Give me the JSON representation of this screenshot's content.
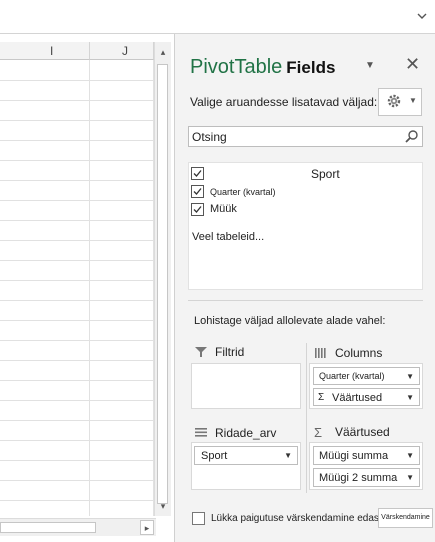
{
  "formula_bar": {
    "expand_icon": "chevron-down-icon"
  },
  "sheet": {
    "columns": [
      "I",
      "J"
    ],
    "hscroll_right_arrow": "▸",
    "vscroll_up_arrow": "▴",
    "vscroll_down_arrow": "▾"
  },
  "pane": {
    "title_part1": "PivotTable",
    "title_part2": "Fields",
    "menu_icon": "▼",
    "close_icon": "✕",
    "choose_label": "Valige aruandesse lisatavad väljad:",
    "search_value": "Otsing",
    "field_list": {
      "header": "Sport",
      "fields": [
        {
          "label": "",
          "checked": true
        },
        {
          "label": "Quarter (kvartal)",
          "checked": true
        },
        {
          "label": "Müük",
          "checked": true
        }
      ],
      "more_tables": "Veel tabeleid..."
    },
    "areas_label": "Lohistage väljad allolevate alade vahel:",
    "areas": {
      "filters": {
        "label": "Filtrid",
        "items": []
      },
      "columns": {
        "label": "Columns",
        "items": [
          "Quarter (kvartal)",
          "Väärtused"
        ]
      },
      "rows": {
        "label": "Ridade_arv",
        "items": [
          "Sport"
        ]
      },
      "values": {
        "label": "Väärtused",
        "items": [
          "Müügi summa",
          "Müügi 2 summa"
        ]
      }
    },
    "defer_label": "Lükka paigutuse värskendamine edasi",
    "update_label": "Värskendamine"
  },
  "colors": {
    "accent_green": "#217346",
    "pane_bg": "#f3f3f3"
  }
}
